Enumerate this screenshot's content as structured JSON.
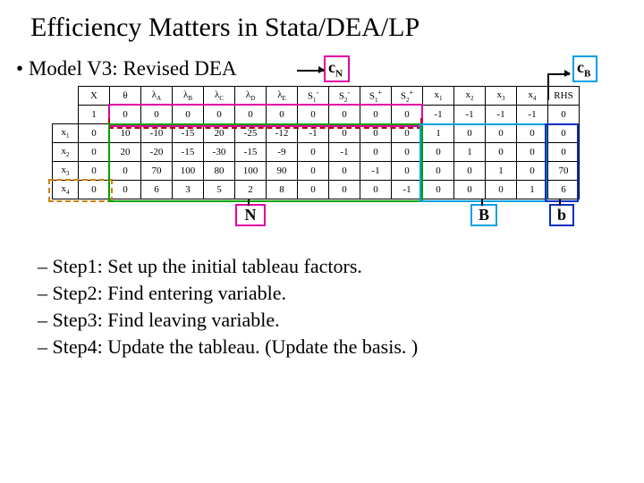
{
  "slide": {
    "title": "Efficiency Matters in Stata/DEA/LP",
    "subtitle_prefix": "• ",
    "subtitle": "Model V3: Revised DEA"
  },
  "badges": {
    "cN": "c",
    "cN_sub": "N",
    "cB": "c",
    "cB_sub": "B"
  },
  "table": {
    "headers": [
      "X",
      "θ",
      "λA",
      "λB",
      "λC",
      "λD",
      "λE",
      "S1-",
      "S2-",
      "S1+",
      "S2+",
      "x1",
      "x2",
      "x3",
      "x4",
      "RHS"
    ],
    "header_subs": [
      "",
      "",
      "A",
      "B",
      "C",
      "D",
      "E",
      "1",
      "2",
      "1",
      "2",
      "1",
      "2",
      "3",
      "4",
      ""
    ],
    "header_pref": [
      "X",
      "θ",
      "λ",
      "λ",
      "λ",
      "λ",
      "λ",
      "S",
      "S",
      "S",
      "S",
      "x",
      "x",
      "x",
      "x",
      "RHS"
    ],
    "header_suf": [
      "",
      "",
      "",
      "",
      "",
      "",
      "",
      "-",
      "-",
      "+",
      "+",
      "",
      "",
      "",
      "",
      ""
    ],
    "rows": [
      {
        "label": "1",
        "cells": [
          "0",
          "0",
          "0",
          "0",
          "0",
          "0",
          "0",
          "0",
          "0",
          "0",
          "-1",
          "-1",
          "-1",
          "-1",
          "0"
        ]
      },
      {
        "label": "x1",
        "lab_pref": "x",
        "lab_sub": "1",
        "cells": [
          "10",
          "-10",
          "-15",
          "20",
          "-25",
          "-12",
          "-1",
          "0",
          "0",
          "0",
          "1",
          "0",
          "0",
          "0",
          "0"
        ]
      },
      {
        "label": "x2",
        "lab_pref": "x",
        "lab_sub": "2",
        "cells": [
          "20",
          "-20",
          "-15",
          "-30",
          "-15",
          "-9",
          "0",
          "-1",
          "0",
          "0",
          "0",
          "1",
          "0",
          "0",
          "0"
        ]
      },
      {
        "label": "x3",
        "lab_pref": "x",
        "lab_sub": "3",
        "cells": [
          "0",
          "70",
          "100",
          "80",
          "100",
          "90",
          "0",
          "0",
          "-1",
          "0",
          "0",
          "0",
          "1",
          "0",
          "70"
        ]
      },
      {
        "label": "x4",
        "lab_pref": "x",
        "lab_sub": "4",
        "cells": [
          "6",
          "3",
          "5",
          "2",
          "8",
          "0",
          "0",
          "0",
          "-1",
          "0",
          "0",
          "0",
          "1",
          "6"
        ]
      }
    ],
    "row4_cells": [
      "0",
      "6",
      "3",
      "5",
      "2",
      "8",
      "0",
      "0",
      "0",
      "-1",
      "0",
      "0",
      "0",
      "1",
      "6"
    ],
    "row0_first": "0",
    "rowlabels_first": "1"
  },
  "underlabels": {
    "N": "N",
    "B": "B",
    "b": "b"
  },
  "steps": [
    "– Step1: Set up the initial tableau factors.",
    "– Step2: Find entering variable.",
    "– Step3: Find leaving variable.",
    "– Step4: Update the tableau. (Update the basis. )"
  ]
}
